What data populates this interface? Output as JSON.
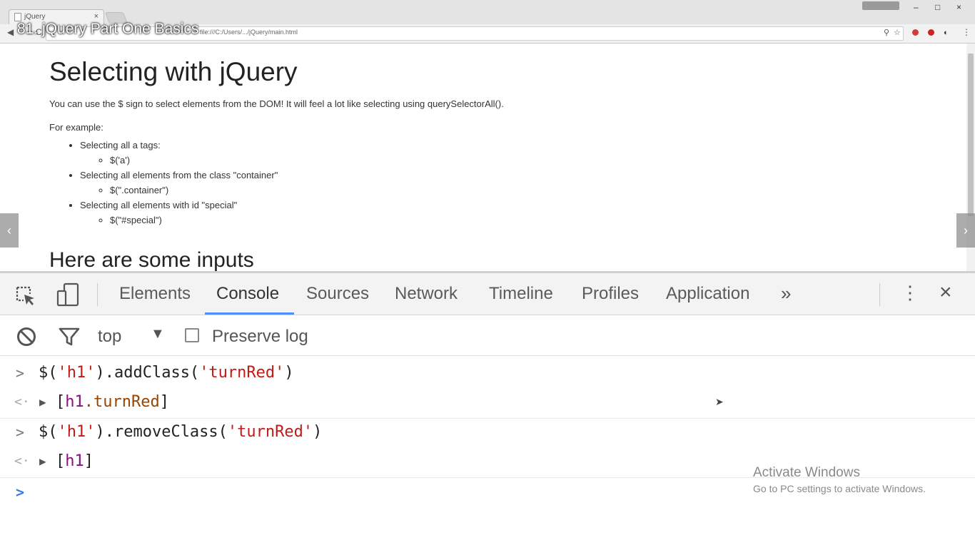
{
  "video": {
    "title": "81. jQuery Part One Basics"
  },
  "browser": {
    "tab_title": "jQuery",
    "tab_close": "×",
    "url": "file:///C:/Users/.../jQuery/main.html",
    "window_buttons": [
      "–",
      "□",
      "×"
    ]
  },
  "page": {
    "heading": "Selecting with jQuery",
    "intro": "You can use the $ sign to select elements from the DOM! It will feel a lot like selecting using querySelectorAll().",
    "example_label": "For example:",
    "examples": [
      {
        "label": "Selecting all a tags:",
        "code": "$('a')"
      },
      {
        "label": "Selecting all elements from the class \"container\"",
        "code": "$(\".container\")"
      },
      {
        "label": "Selecting all elements with id \"special\"",
        "code": "$(\"#special\")"
      }
    ],
    "subheading": "Here are some inputs"
  },
  "devtools": {
    "tabs": [
      "Elements",
      "Console",
      "Sources",
      "Network",
      "Timeline",
      "Profiles",
      "Application"
    ],
    "active_tab": "Console",
    "more_tabs": "»",
    "menu": "⋮",
    "close": "×",
    "context": "top",
    "context_arrow": "▼",
    "preserve_log_label": "Preserve log",
    "preserve_log_checked": false,
    "accent_color": "#4d90fe"
  },
  "console": {
    "entries": [
      {
        "kind": "input",
        "prefix": "$(",
        "arg": "'h1'",
        "method": ").addClass(",
        "arg2": "'turnRed'",
        "suffix": ")"
      },
      {
        "kind": "result",
        "open": "[",
        "tag": "h1",
        "cls": ".turnRed",
        "close": "]"
      },
      {
        "kind": "input",
        "prefix": "$(",
        "arg": "'h1'",
        "method": ").removeClass(",
        "arg2": "'turnRed'",
        "suffix": ")"
      },
      {
        "kind": "result",
        "open": "[",
        "tag": "h1",
        "close": "]"
      }
    ],
    "prompt_symbol": ">",
    "result_symbol": "<·"
  },
  "watermark": {
    "title": "Activate Windows",
    "subtitle": "Go to PC settings to activate Windows."
  }
}
